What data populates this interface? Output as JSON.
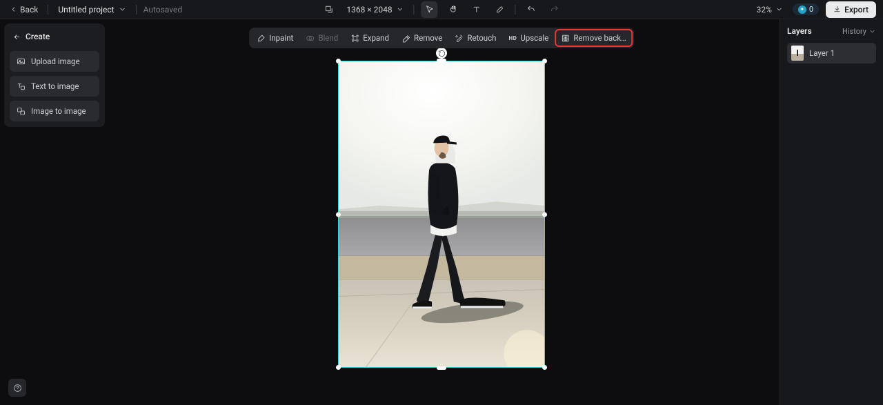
{
  "header": {
    "back": "Back",
    "project_name": "Untitled project",
    "autosave": "Autosaved",
    "canvas_size": "1368 × 2048",
    "zoom": "32%",
    "credits": "0",
    "export": "Export"
  },
  "left_panel": {
    "title": "Create",
    "items": [
      {
        "label": "Upload image",
        "icon": "upload-image-icon"
      },
      {
        "label": "Text to image",
        "icon": "text-to-image-icon"
      },
      {
        "label": "Image to image",
        "icon": "image-to-image-icon"
      }
    ]
  },
  "context_toolbar": {
    "items": [
      {
        "label": "Inpaint",
        "icon": "inpaint-icon",
        "enabled": true
      },
      {
        "label": "Blend",
        "icon": "blend-icon",
        "enabled": false
      },
      {
        "label": "Expand",
        "icon": "expand-icon",
        "enabled": true
      },
      {
        "label": "Remove",
        "icon": "remove-icon",
        "enabled": true
      },
      {
        "label": "Retouch",
        "icon": "retouch-icon",
        "enabled": true
      },
      {
        "label": "Upscale",
        "icon": "upscale-icon",
        "enabled": true
      },
      {
        "label": "Remove back…",
        "icon": "remove-bg-icon",
        "enabled": true,
        "highlight": true
      }
    ]
  },
  "right_panel": {
    "title": "Layers",
    "history": "History",
    "layers": [
      {
        "name": "Layer 1"
      }
    ]
  },
  "help_tooltip": "Help"
}
